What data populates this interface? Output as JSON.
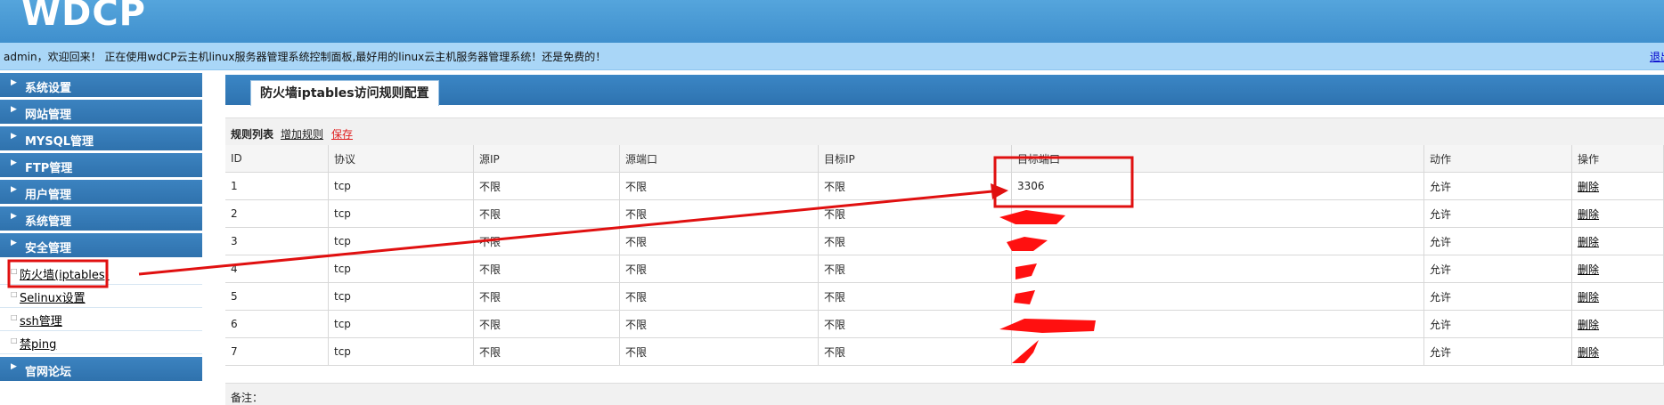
{
  "header": {
    "logo": "WDCP"
  },
  "welcome": {
    "text": "admin，欢迎回来！ 正在使用wdCP云主机linux服务器管理系统控制面板,最好用的linux云主机服务器管理系统！还是免费的！",
    "logout": "退出"
  },
  "sidebar": {
    "items": [
      {
        "label": "系统设置"
      },
      {
        "label": "网站管理"
      },
      {
        "label": "MYSQL管理"
      },
      {
        "label": "FTP管理"
      },
      {
        "label": "用户管理"
      },
      {
        "label": "系统管理"
      },
      {
        "label": "安全管理"
      }
    ],
    "security_sub": [
      {
        "label": "防火墙(iptables)"
      },
      {
        "label": "Selinux设置"
      },
      {
        "label": "ssh管理"
      },
      {
        "label": "禁ping"
      }
    ],
    "forum": {
      "label": "官网论坛"
    }
  },
  "main": {
    "tab_title": "防火墙iptables访问规则配置",
    "list_title": "规则列表",
    "add_rule": "增加规则",
    "save": "保存",
    "columns": [
      "ID",
      "协议",
      "源IP",
      "源端口",
      "目标IP",
      "目标端口",
      "动作",
      "操作"
    ],
    "rows": [
      {
        "id": "1",
        "proto": "tcp",
        "src_ip": "不限",
        "src_port": "不限",
        "dst_ip": "不限",
        "dst_port": "3306",
        "action": "允许",
        "op": "删除"
      },
      {
        "id": "2",
        "proto": "tcp",
        "src_ip": "不限",
        "src_port": "不限",
        "dst_ip": "不限",
        "dst_port": "",
        "action": "允许",
        "op": "删除"
      },
      {
        "id": "3",
        "proto": "tcp",
        "src_ip": "不限",
        "src_port": "不限",
        "dst_ip": "不限",
        "dst_port": "",
        "action": "允许",
        "op": "删除"
      },
      {
        "id": "4",
        "proto": "tcp",
        "src_ip": "不限",
        "src_port": "不限",
        "dst_ip": "不限",
        "dst_port": "",
        "action": "允许",
        "op": "删除"
      },
      {
        "id": "5",
        "proto": "tcp",
        "src_ip": "不限",
        "src_port": "不限",
        "dst_ip": "不限",
        "dst_port": "",
        "action": "允许",
        "op": "删除"
      },
      {
        "id": "6",
        "proto": "tcp",
        "src_ip": "不限",
        "src_port": "不限",
        "dst_ip": "不限",
        "dst_port": "",
        "action": "允许",
        "op": "删除"
      },
      {
        "id": "7",
        "proto": "tcp",
        "src_ip": "不限",
        "src_port": "不限",
        "dst_ip": "不限",
        "dst_port": "",
        "action": "允许",
        "op": "删除"
      }
    ],
    "remark": "备注："
  },
  "colors": {
    "header": "#4a9ad6",
    "welcome_bar": "#a9d6f7",
    "menu": "#3479b6",
    "annotation": "#e01010"
  }
}
